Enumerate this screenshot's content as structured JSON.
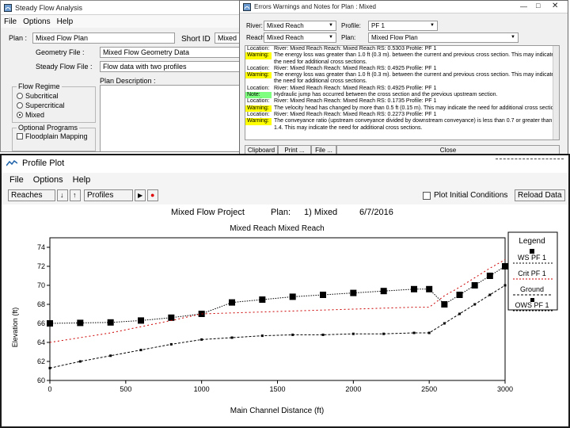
{
  "steady_flow_window": {
    "title": "Steady Flow Analysis",
    "menu": [
      "File",
      "Options",
      "Help"
    ],
    "plan_label": "Plan :",
    "plan_value": "Mixed Flow Plan",
    "short_id_label": "Short ID",
    "short_id_value": "Mixed",
    "geometry_label": "Geometry File :",
    "geometry_value": "Mixed Flow Geometry Data",
    "steady_label": "Steady Flow File :",
    "steady_value": "Flow data with two profiles",
    "plan_description_label": "Plan Description :",
    "flow_regime_label": "Flow Regime",
    "regimes": [
      "Subcritical",
      "Supercritical",
      "Mixed"
    ],
    "selected_regime": "Mixed",
    "optional_programs_label": "Optional Programs",
    "floodplain_label": "Floodplain Mapping"
  },
  "errors_window": {
    "title": "Errors Warnings and Notes for Plan : Mixed",
    "river_label": "River:",
    "river_value": "Mixed Reach",
    "profile_label": "Profile:",
    "profile_value": "PF 1",
    "reach_label": "Reach:",
    "reach_value": "Mixed Reach",
    "plan_label": "Plan:",
    "plan_value": "Mixed Flow Plan",
    "messages": [
      {
        "tag": "Location:",
        "kind": "loc",
        "text": "River: Mixed Reach  Reach: Mixed Reach    RS: 0.5303    Profile: PF 1"
      },
      {
        "tag": "Warning:",
        "kind": "warn",
        "text": "The energy loss was greater than 1.0 ft (0.3 m). between the current and previous cross section.  This may indicate"
      },
      {
        "tag": "",
        "kind": "loc",
        "text": "the need for additional cross sections."
      },
      {
        "tag": "Location:",
        "kind": "loc",
        "text": "River: Mixed Reach  Reach: Mixed Reach    RS: 0.4925    Profile: PF 1"
      },
      {
        "tag": "Warning:",
        "kind": "warn",
        "text": "The energy loss was greater than 1.0 ft (0.3 m). between the current and previous cross section.  This may indicate"
      },
      {
        "tag": "",
        "kind": "loc",
        "text": "the need for additional cross sections."
      },
      {
        "tag": "Location:",
        "kind": "loc",
        "text": "River: Mixed Reach  Reach: Mixed Reach    RS: 0.4925    Profile: PF 1"
      },
      {
        "tag": "Note:",
        "kind": "note",
        "text": "Hydraulic jump has occurred between the cross section and the previous upstream section."
      },
      {
        "tag": "Location:",
        "kind": "loc",
        "text": "River: Mixed Reach  Reach: Mixed Reach    RS: 0.1735    Profile: PF 1"
      },
      {
        "tag": "Warning:",
        "kind": "warn",
        "text": "The velocity head has changed by more than 0.5 ft (0.15 m).  This may indicate the need for additional cross sections."
      },
      {
        "tag": "Location:",
        "kind": "loc",
        "text": "River: Mixed Reach  Reach: Mixed Reach    RS: 0.2273    Profile: PF 1"
      },
      {
        "tag": "Warning:",
        "kind": "warn",
        "text": "The conveyance ratio (upstream conveyance divided by downstream conveyance) is less than 0.7 or greater than"
      },
      {
        "tag": "",
        "kind": "loc",
        "text": "1.4.  This may indicate the need for additional cross sections."
      }
    ],
    "buttons": [
      "Clipboard",
      "Print ...",
      "File ...",
      "Close"
    ]
  },
  "profile_window": {
    "title": "Profile Plot",
    "menu": [
      "File",
      "Options",
      "Help"
    ],
    "reaches_label": "Reaches",
    "profiles_label": "Profiles",
    "plot_initial_label": "Plot Initial Conditions",
    "reload_label": "Reload Data"
  },
  "chart_data": {
    "type": "line",
    "title_parts": [
      "Mixed Flow Project",
      "Plan:",
      "1) Mixed",
      "6/7/2016"
    ],
    "subtitle": "Mixed Reach Mixed Reach",
    "xlabel": "Main Channel Distance (ft)",
    "ylabel": "Elevation (ft)",
    "xlim": [
      0,
      3000
    ],
    "ylim": [
      60,
      75
    ],
    "xticks": [
      0,
      500,
      1000,
      1500,
      2000,
      2500,
      3000
    ],
    "yticks": [
      60,
      62,
      64,
      66,
      68,
      70,
      72,
      74
    ],
    "legend_title": "Legend",
    "series": [
      {
        "name": "WS  PF 1",
        "style": "ws",
        "color": "#000000",
        "x": [
          0,
          200,
          400,
          600,
          800,
          1000,
          1200,
          1400,
          1600,
          1800,
          2000,
          2200,
          2400,
          2500,
          2600,
          2700,
          2800,
          2900,
          3000
        ],
        "y": [
          66.0,
          66.05,
          66.1,
          66.3,
          66.6,
          67.0,
          68.2,
          68.5,
          68.8,
          69.0,
          69.2,
          69.4,
          69.6,
          69.6,
          68.0,
          69.0,
          70.0,
          71.0,
          72.0
        ]
      },
      {
        "name": "Crit  PF 1",
        "style": "crit",
        "color": "#cc0000",
        "x": [
          0,
          400,
          800,
          1000,
          1200,
          1600,
          2000,
          2200,
          2400,
          2500,
          2600,
          2700,
          2800,
          2900,
          3000
        ],
        "y": [
          64.0,
          65.0,
          66.3,
          67.0,
          67.1,
          67.3,
          67.5,
          67.6,
          67.7,
          67.7,
          68.9,
          69.8,
          70.8,
          71.8,
          72.7
        ]
      },
      {
        "name": "Ground",
        "style": "ground",
        "color": "#000000",
        "x": [
          0,
          200,
          400,
          600,
          800,
          1000,
          1200,
          1400,
          1600,
          1800,
          2000,
          2200,
          2400,
          2500,
          2600,
          2700,
          2800,
          2900,
          3000
        ],
        "y": [
          61.3,
          62.0,
          62.6,
          63.2,
          63.8,
          64.3,
          64.5,
          64.7,
          64.8,
          64.8,
          64.9,
          64.9,
          65.0,
          65.0,
          66.0,
          67.0,
          68.0,
          69.0,
          70.0
        ]
      },
      {
        "name": "OWS  PF 1",
        "style": "ows",
        "color": "#000000",
        "x": [],
        "y": []
      }
    ]
  }
}
